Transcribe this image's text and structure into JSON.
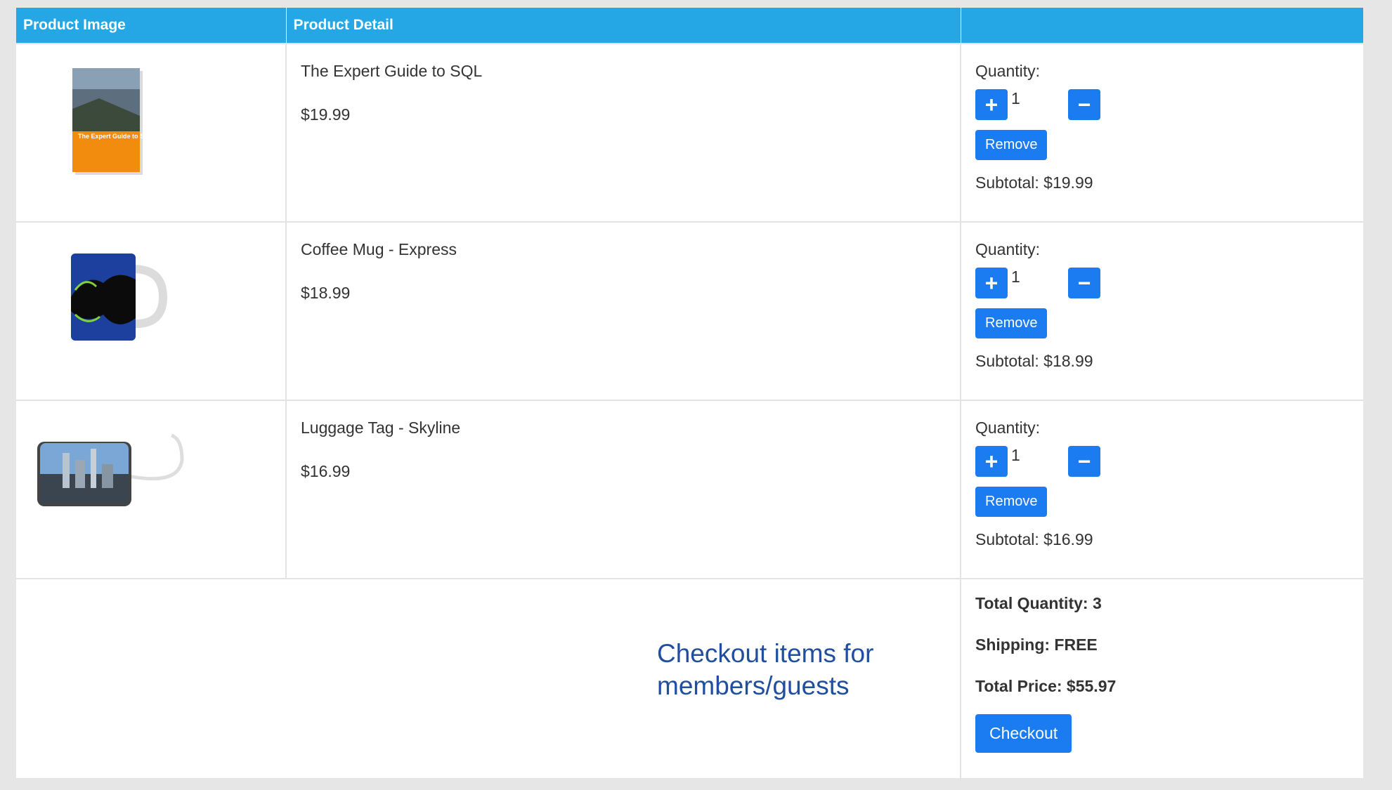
{
  "header": {
    "col1": "Product Image",
    "col2": "Product Detail",
    "col3": ""
  },
  "items": [
    {
      "name": "The Expert Guide to SQL",
      "price": "$19.99",
      "quantity_label": "Quantity:",
      "quantity": "1",
      "remove_label": "Remove",
      "subtotal": "Subtotal: $19.99",
      "image": "book-cover",
      "book_title": "The Expert Guide to SQL"
    },
    {
      "name": "Coffee Mug - Express",
      "price": "$18.99",
      "quantity_label": "Quantity:",
      "quantity": "1",
      "remove_label": "Remove",
      "subtotal": "Subtotal: $18.99",
      "image": "coffee-mug"
    },
    {
      "name": "Luggage Tag - Skyline",
      "price": "$16.99",
      "quantity_label": "Quantity:",
      "quantity": "1",
      "remove_label": "Remove",
      "subtotal": "Subtotal: $16.99",
      "image": "luggage-tag"
    }
  ],
  "summary": {
    "total_quantity": "Total Quantity: 3",
    "shipping": "Shipping: FREE",
    "total_price": "Total Price: $55.97",
    "checkout_label": "Checkout"
  },
  "caption": "Checkout items for members/guests",
  "icons": {
    "plus": "plus-icon",
    "minus": "minus-icon"
  },
  "colors": {
    "header": "#25a7e5",
    "button": "#1a7cf0",
    "caption": "#1f4f9e"
  }
}
